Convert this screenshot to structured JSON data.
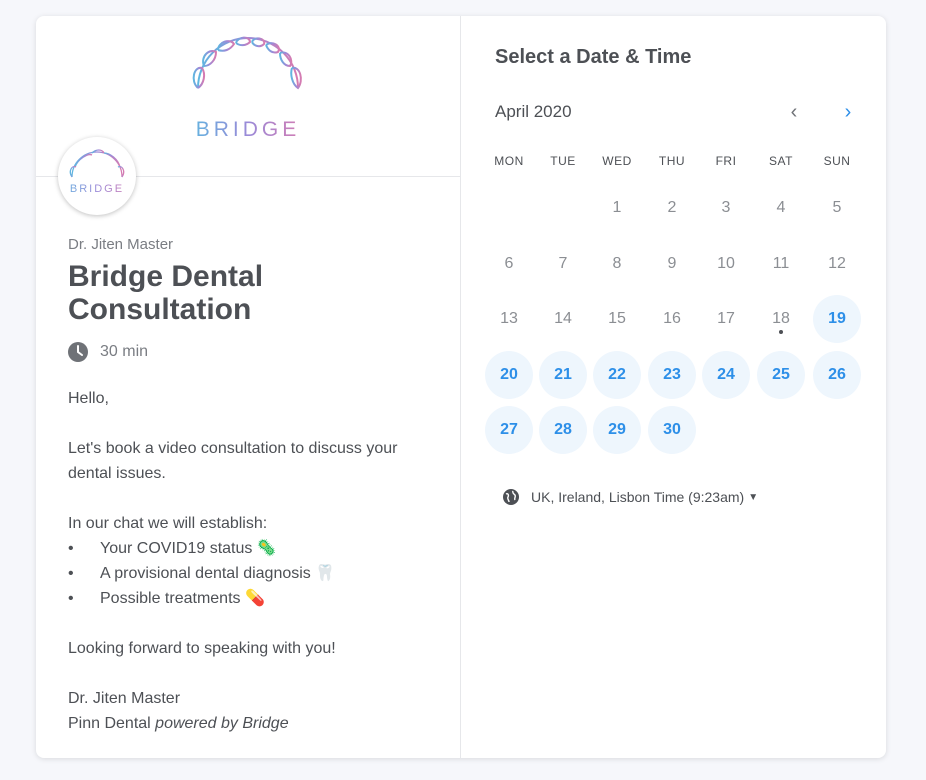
{
  "brand": {
    "wordmark": "BRIDGE"
  },
  "event": {
    "host": "Dr. Jiten Master",
    "title": "Bridge Dental Consultation",
    "duration": "30 min",
    "greeting": "Hello,",
    "intro": "Let's book a video consultation to discuss your dental issues.",
    "establish_heading": "In our chat we will establish:",
    "items": [
      {
        "text": "Your COVID19 status",
        "emoji": "🦠"
      },
      {
        "text": "A provisional dental diagnosis",
        "emoji": "🦷"
      },
      {
        "text": "Possible treatments",
        "emoji": "💊"
      }
    ],
    "closing": "Looking forward to speaking with you!",
    "signature_name": "Dr. Jiten Master",
    "signature_company": "Pinn Dental",
    "powered_by": "powered by Bridge"
  },
  "calendar": {
    "heading": "Select a Date & Time",
    "month": "April 2020",
    "weekdays": [
      "MON",
      "TUE",
      "WED",
      "THU",
      "FRI",
      "SAT",
      "SUN"
    ],
    "first_weekday_index": 2,
    "days_in_month": 30,
    "today": 18,
    "available": [
      19,
      20,
      21,
      22,
      23,
      24,
      25,
      26,
      27,
      28,
      29,
      30
    ],
    "timezone": "UK, Ireland, Lisbon Time (9:23am)"
  },
  "colors": {
    "accent": "#2d8fe8",
    "available_bg": "#eef6fd",
    "logo_gradient": [
      "#5fb6e0",
      "#9b8ad8",
      "#d77bb0"
    ]
  },
  "icons": {
    "clock": "clock-icon",
    "globe": "globe-icon",
    "prev": "chevron-left-icon",
    "next": "chevron-right-icon",
    "caret": "caret-down-icon"
  }
}
